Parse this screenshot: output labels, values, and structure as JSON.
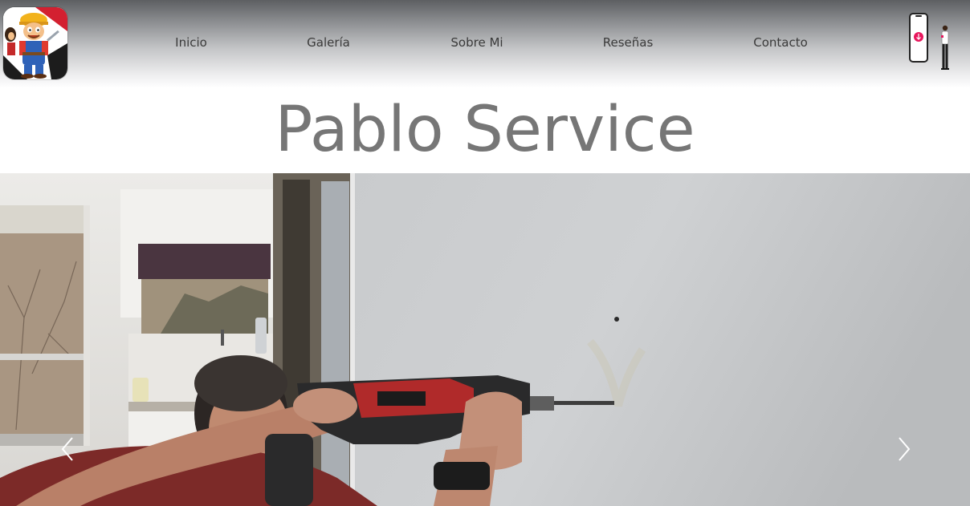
{
  "site": {
    "title": "Pablo Service"
  },
  "header": {
    "logo_icon": "handyman-mascot-logo",
    "nav": [
      {
        "label": "Inicio"
      },
      {
        "label": "Galería"
      },
      {
        "label": "Sobre Mi"
      },
      {
        "label": "Reseñas"
      },
      {
        "label": "Contacto"
      }
    ],
    "badge_icon": "phone-download-icon"
  },
  "hero": {
    "image": "man-drilling-wall-photo",
    "prev_icon": "chevron-left-icon",
    "next_icon": "chevron-right-icon"
  },
  "colors": {
    "title": "#767676",
    "nav_text": "#3a3a3a",
    "accent": "#e8175d"
  }
}
